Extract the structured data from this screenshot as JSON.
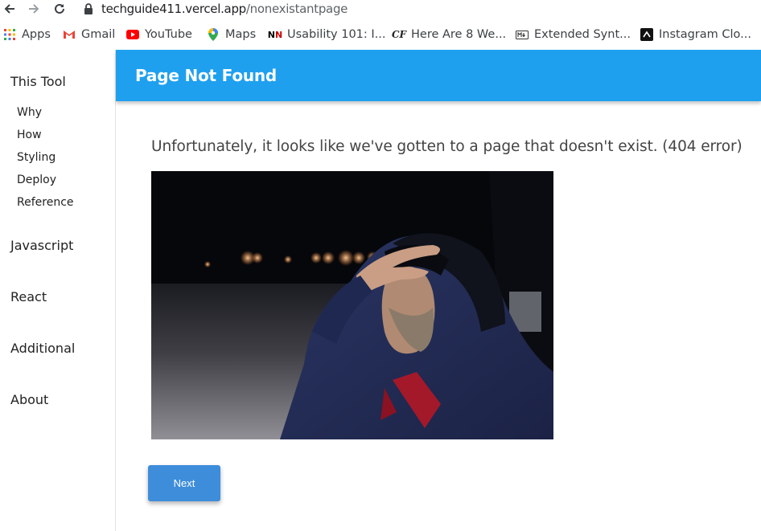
{
  "browser": {
    "url_domain": "techguide411.vercel.app",
    "url_path": "/nonexistantpage",
    "bookmarks": [
      {
        "label": "Apps",
        "icon": "apps-grid-icon"
      },
      {
        "label": "Gmail",
        "icon": "gmail-icon"
      },
      {
        "label": "YouTube",
        "icon": "youtube-icon"
      },
      {
        "label": "Maps",
        "icon": "maps-icon"
      },
      {
        "label": "Usability 101: I...",
        "icon": "nn-icon"
      },
      {
        "label": "Here Are 8 We...",
        "icon": "cf-icon"
      },
      {
        "label": "Extended Synt...",
        "icon": "markdown-icon"
      },
      {
        "label": "Instagram Clo...",
        "icon": "instagram-clone-icon"
      }
    ]
  },
  "sidebar": {
    "sections": [
      {
        "label": "This Tool",
        "items": [
          "Why",
          "How",
          "Styling",
          "Deploy",
          "Reference"
        ]
      },
      {
        "label": "Javascript"
      },
      {
        "label": "React"
      },
      {
        "label": "Additional"
      },
      {
        "label": "About"
      }
    ]
  },
  "header": {
    "title": "Page Not Found"
  },
  "main": {
    "message": "Unfortunately, it looks like we've gotten to a page that doesn't exist. (404 error)",
    "next_label": "Next"
  },
  "colors": {
    "header_bg": "#1fa0ef",
    "button_bg": "#3d8ddb"
  }
}
